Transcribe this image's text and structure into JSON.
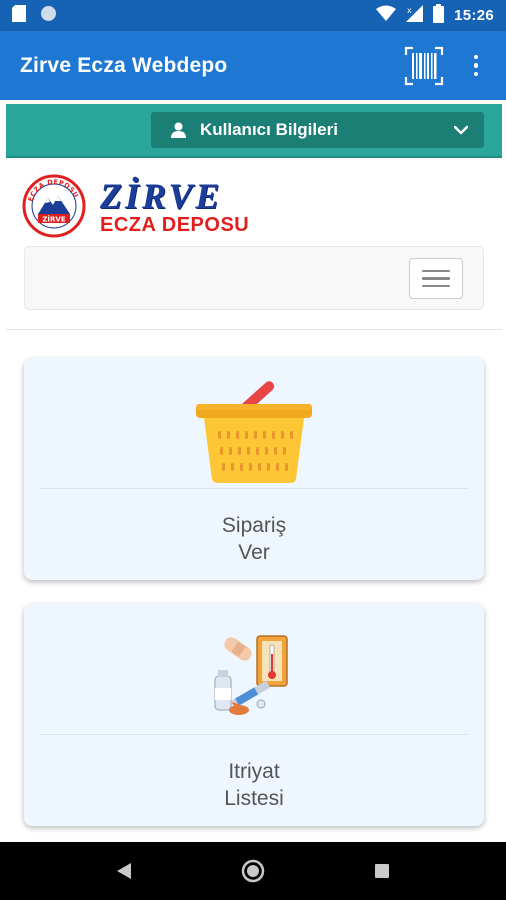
{
  "status_bar": {
    "time": "15:26"
  },
  "app_bar": {
    "title": "Zirve Ecza Webdepo"
  },
  "user_menu": {
    "label": "Kullanıcı Bilgileri"
  },
  "logo": {
    "name": "ZİRVE",
    "subtitle": "ECZA DEPOSU",
    "seal_top": "ECZA DEPOSU",
    "seal_bottom": "ZİRVE"
  },
  "cards": [
    {
      "line1": "Sipariş",
      "line2": "Ver",
      "icon": "basket-icon"
    },
    {
      "line1": "Itriyat",
      "line2": "Listesi",
      "icon": "pharmacy-supplies-icon"
    }
  ],
  "colors": {
    "status_bar": "#1662b4",
    "app_bar": "#1d77d3",
    "user_strip": "#2aa79a",
    "user_dropdown": "#1b7f76",
    "card_bg": "#eef6ff",
    "logo_blue": "#1c3e99",
    "logo_red": "#e0201f"
  }
}
